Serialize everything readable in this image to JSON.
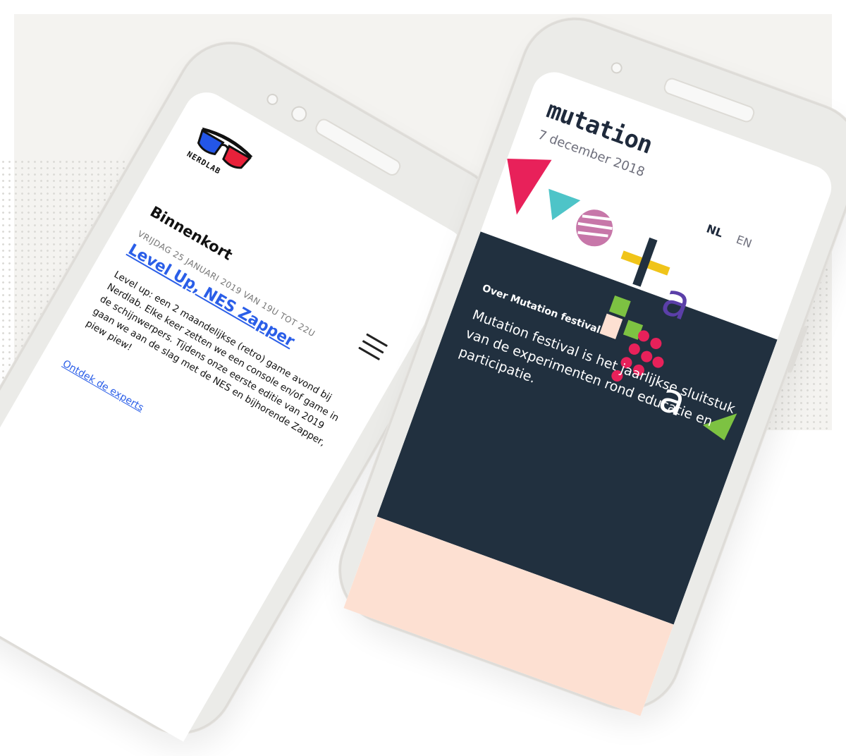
{
  "colors": {
    "background": "#f4f3f0",
    "nerdlab_link": "#2a5ee8",
    "mutation_navy": "#21303f",
    "mutation_peach": "#fde0d2",
    "shape_red": "#e8215a",
    "shape_teal": "#4ec4c8",
    "shape_purple": "#c777a9",
    "shape_yellow": "#f0c419",
    "shape_violet": "#5b3fa8",
    "shape_green": "#7dc242"
  },
  "phone_left": {
    "logo_icon": "3d-glasses-icon",
    "brand": "NERDLAB",
    "menu_icon": "hamburger-menu-icon",
    "section_title": "Binnenkort",
    "event": {
      "date": "VRIJDAG 25 JANUARI 2019 VAN 19U TOT 22U",
      "title": "Level Up, NES Zapper",
      "description": "Level up: een 2 maandelijkse (retro) game avond bij Nerdlab. Elke keer zetten we een console en/of game in de schijnwerpers. Tijdens onze eerste editie van 2019 gaan we aan de slag met de NES en bijhorende Zapper, piew piew!"
    },
    "cta_link": "Ontdek de experts"
  },
  "phone_right": {
    "logo": "mutation",
    "date": "7 december 2018",
    "languages": [
      "NL",
      "EN"
    ],
    "about": {
      "title": "Over Mutation festival",
      "body": "Mutation festival is het jaarlijkse sluitstuk van de experimenten rond educatie en participatie."
    }
  }
}
